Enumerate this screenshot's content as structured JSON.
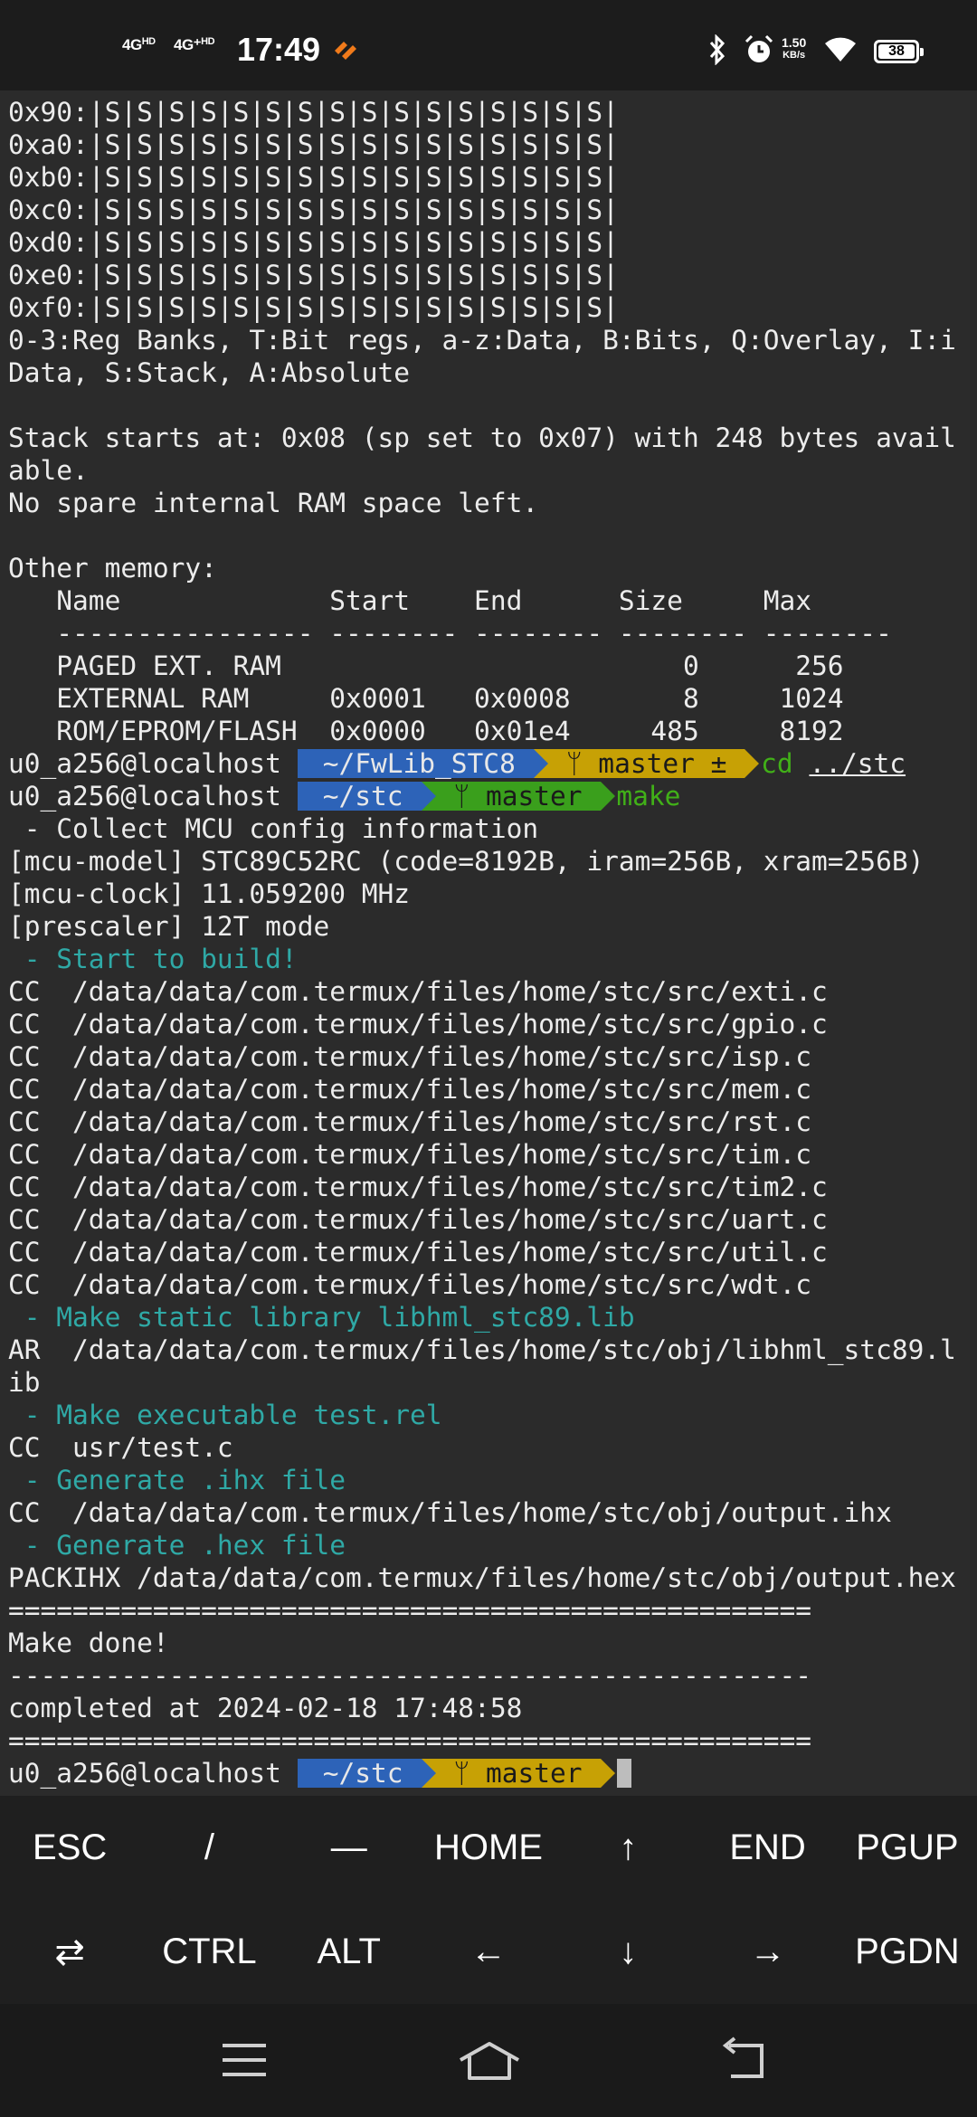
{
  "status_bar": {
    "signal1": {
      "label": "4G",
      "sup": "HD"
    },
    "signal2": {
      "label": "4G⁺",
      "sup": "HD"
    },
    "time": "17:49",
    "speed_value": "1.50",
    "speed_unit": "KB/s",
    "battery": "38"
  },
  "terminal": {
    "pre_lines": [
      "0x90:|S|S|S|S|S|S|S|S|S|S|S|S|S|S|S|S|",
      "0xa0:|S|S|S|S|S|S|S|S|S|S|S|S|S|S|S|S|",
      "0xb0:|S|S|S|S|S|S|S|S|S|S|S|S|S|S|S|S|",
      "0xc0:|S|S|S|S|S|S|S|S|S|S|S|S|S|S|S|S|",
      "0xd0:|S|S|S|S|S|S|S|S|S|S|S|S|S|S|S|S|",
      "0xe0:|S|S|S|S|S|S|S|S|S|S|S|S|S|S|S|S|",
      "0xf0:|S|S|S|S|S|S|S|S|S|S|S|S|S|S|S|S|",
      "0-3:Reg Banks, T:Bit regs, a-z:Data, B:Bits, Q:Overlay, I:i",
      "Data, S:Stack, A:Absolute",
      "",
      "Stack starts at: 0x08 (sp set to 0x07) with 248 bytes avail",
      "able.",
      "No spare internal RAM space left.",
      "",
      "Other memory:",
      "   Name             Start    End      Size     Max",
      "   ---------------- -------- -------- -------- --------",
      "   PAGED EXT. RAM                         0      256",
      "   EXTERNAL RAM     0x0001   0x0008       8     1024",
      "   ROM/EPROM/FLASH  0x0000   0x01e4     485     8192"
    ],
    "prompt1": {
      "user": "u0_a256@localhost",
      "path": "~/FwLib_STC8",
      "branch": "ᛘ master ±",
      "cmd": "cd",
      "arg": "../stc"
    },
    "prompt2": {
      "user": "u0_a256@localhost",
      "path": "~/stc",
      "branch": "ᛘ master",
      "cmd": "make"
    },
    "build_lines": [
      {
        "text": " - Collect MCU config information",
        "style": "normal"
      },
      {
        "text": "[mcu-model] STC89C52RC (code=8192B, iram=256B, xram=256B)",
        "style": "normal"
      },
      {
        "text": "[mcu-clock] 11.059200 MHz",
        "style": "normal"
      },
      {
        "text": "[prescaler] 12T mode",
        "style": "normal"
      },
      {
        "text": " - Start to build!",
        "style": "cyan"
      },
      {
        "text": "CC  /data/data/com.termux/files/home/stc/src/exti.c",
        "style": "normal"
      },
      {
        "text": "CC  /data/data/com.termux/files/home/stc/src/gpio.c",
        "style": "normal"
      },
      {
        "text": "CC  /data/data/com.termux/files/home/stc/src/isp.c",
        "style": "normal"
      },
      {
        "text": "CC  /data/data/com.termux/files/home/stc/src/mem.c",
        "style": "normal"
      },
      {
        "text": "CC  /data/data/com.termux/files/home/stc/src/rst.c",
        "style": "normal"
      },
      {
        "text": "CC  /data/data/com.termux/files/home/stc/src/tim.c",
        "style": "normal"
      },
      {
        "text": "CC  /data/data/com.termux/files/home/stc/src/tim2.c",
        "style": "normal"
      },
      {
        "text": "CC  /data/data/com.termux/files/home/stc/src/uart.c",
        "style": "normal"
      },
      {
        "text": "CC  /data/data/com.termux/files/home/stc/src/util.c",
        "style": "normal"
      },
      {
        "text": "CC  /data/data/com.termux/files/home/stc/src/wdt.c",
        "style": "normal"
      },
      {
        "text": " - Make static library libhml_stc89.lib",
        "style": "cyan"
      },
      {
        "text": "AR  /data/data/com.termux/files/home/stc/obj/libhml_stc89.l",
        "style": "normal"
      },
      {
        "text": "ib",
        "style": "normal"
      },
      {
        "text": " - Make executable test.rel",
        "style": "cyan"
      },
      {
        "text": "CC  usr/test.c",
        "style": "normal"
      },
      {
        "text": " - Generate .ihx file",
        "style": "cyan"
      },
      {
        "text": "CC  /data/data/com.termux/files/home/stc/obj/output.ihx",
        "style": "normal"
      },
      {
        "text": " - Generate .hex file",
        "style": "cyan"
      },
      {
        "text": "PACKIHX /data/data/com.termux/files/home/stc/obj/output.hex",
        "style": "normal"
      },
      {
        "text": "==================================================",
        "style": "normal"
      },
      {
        "text": "Make done!",
        "style": "normal"
      },
      {
        "text": "--------------------------------------------------",
        "style": "normal"
      },
      {
        "text": "completed at 2024-02-18 17:48:58",
        "style": "normal"
      },
      {
        "text": "==================================================",
        "style": "normal"
      }
    ],
    "prompt3": {
      "user": "u0_a256@localhost",
      "path": "~/stc",
      "branch": "ᛘ master"
    }
  },
  "extra_keys": {
    "row1": [
      "ESC",
      "/",
      "—",
      "HOME",
      "↑",
      "END",
      "PGUP"
    ],
    "row2": [
      "⇄",
      "CTRL",
      "ALT",
      "←",
      "↓",
      "→",
      "PGDN"
    ]
  },
  "nav_bar": {
    "icons": [
      "menu-icon",
      "home-icon",
      "back-icon"
    ]
  },
  "colors": {
    "terminal_bg": "#2b2b2b",
    "path_segment": "#2d63b8",
    "branch_dirty": "#c7a105",
    "branch_clean": "#3a9f1c",
    "section_text": "#2fa9a6"
  }
}
